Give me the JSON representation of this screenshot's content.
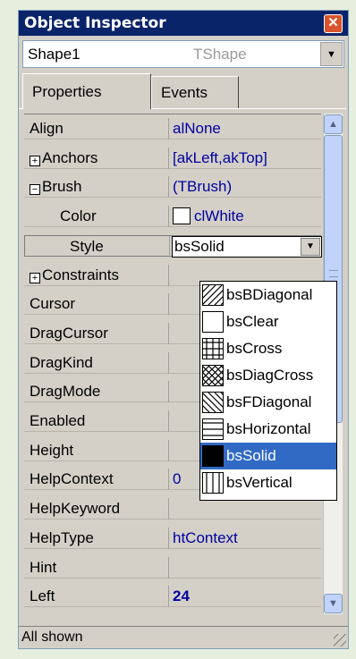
{
  "window": {
    "title": "Object Inspector",
    "close_glyph": "✕"
  },
  "object_selector": {
    "name": "Shape1",
    "type": "TShape"
  },
  "tabs": [
    {
      "label": "Properties"
    },
    {
      "label": "Events"
    }
  ],
  "properties": [
    {
      "name": "Align",
      "value": "alNone"
    },
    {
      "name": "Anchors",
      "value": "[akLeft,akTop]",
      "expander": "+"
    },
    {
      "name": "Brush",
      "value": "(TBrush)",
      "expander": "−"
    },
    {
      "name": "Color",
      "value": "clWhite"
    },
    {
      "name": "Style",
      "value": "bsSolid"
    },
    {
      "name": "Constraints",
      "value": "",
      "expander": "+"
    },
    {
      "name": "Cursor",
      "value": ""
    },
    {
      "name": "DragCursor",
      "value": ""
    },
    {
      "name": "DragKind",
      "value": ""
    },
    {
      "name": "DragMode",
      "value": ""
    },
    {
      "name": "Enabled",
      "value": ""
    },
    {
      "name": "Height",
      "value": ""
    },
    {
      "name": "HelpContext",
      "value": "0"
    },
    {
      "name": "HelpKeyword",
      "value": ""
    },
    {
      "name": "HelpType",
      "value": "htContext"
    },
    {
      "name": "Hint",
      "value": ""
    },
    {
      "name": "Left",
      "value": "24"
    }
  ],
  "style_dropdown": {
    "options": [
      "bsBDiagonal",
      "bsClear",
      "bsCross",
      "bsDiagCross",
      "bsFDiagonal",
      "bsHorizontal",
      "bsSolid",
      "bsVertical"
    ],
    "selected": "bsSolid"
  },
  "status": {
    "text": "All shown"
  },
  "colors": {
    "title_bg": "#0a246a",
    "value_text": "#0000a0",
    "selection": "#316ac5",
    "panel": "#d4d0c8"
  }
}
